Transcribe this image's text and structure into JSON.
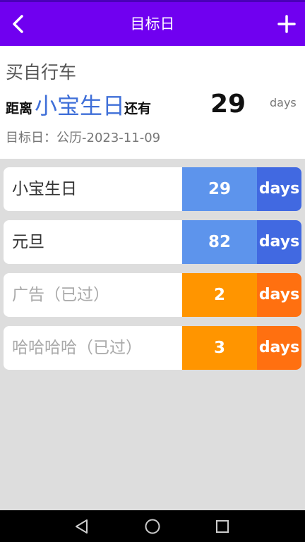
{
  "topbar": {
    "title": "目标日",
    "back_icon": "chevron-left-icon",
    "add_icon": "plus-icon",
    "color": "#7000f0"
  },
  "header": {
    "event_name": "买自行车",
    "prefix": "距离",
    "highlight": "小宝生日",
    "suffix": "还有",
    "days": "29",
    "unit": "days",
    "target_date": "目标日：公历-2023-11-09"
  },
  "events": [
    {
      "label": "小宝生日",
      "days": "29",
      "unit": "days",
      "num_color": "#5d94ec",
      "unit_color": "#4169e1"
    },
    {
      "label": "元旦",
      "days": "82",
      "unit": "days",
      "num_color": "#5d94ec",
      "unit_color": "#4169e1"
    },
    {
      "label": "广告（已过）",
      "days": "2",
      "unit": "days",
      "num_color": "#ff9500",
      "unit_color": "#ff7010"
    },
    {
      "label": "哈哈哈哈（已过）",
      "days": "3",
      "unit": "days",
      "num_color": "#ff9500",
      "unit_color": "#ff7010"
    }
  ],
  "navbar": {
    "back_icon": "triangle-back-icon",
    "home_icon": "circle-home-icon",
    "recents_icon": "square-recents-icon"
  }
}
